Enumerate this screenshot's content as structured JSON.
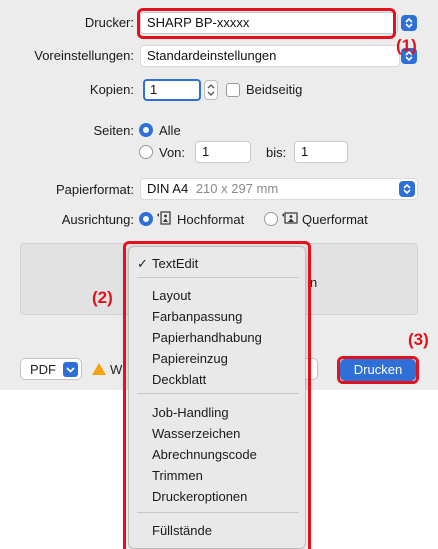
{
  "printer": {
    "label": "Drucker:",
    "value": "SHARP BP-xxxxx"
  },
  "presets": {
    "label": "Voreinstellungen:",
    "value": "Standardeinstellungen"
  },
  "copies": {
    "label": "Kopien:",
    "value": "1",
    "duplex_label": "Beidseitig"
  },
  "pages": {
    "label": "Seiten:",
    "all_label": "Alle",
    "from_label": "Von:",
    "from_value": "1",
    "to_label": "bis:",
    "to_value": "1"
  },
  "paper": {
    "label": "Papierformat:",
    "value": "DIN A4",
    "dimensions": "210 x 297 mm"
  },
  "orientation": {
    "label": "Ausrichtung:",
    "portrait_label": "Hochformat",
    "landscape_label": "Querformat"
  },
  "panel": {
    "partial_text": "n"
  },
  "bottom": {
    "pdf_label": "PDF",
    "warning_partial": "W",
    "print_label": "Drucken"
  },
  "callouts": {
    "c1": "(1)",
    "c2": "(2)",
    "c3": "(3)"
  },
  "menu": {
    "checked_item": "TextEdit",
    "check_mark": "✓",
    "group1": [
      "Layout",
      "Farbanpassung",
      "Papierhandhabung",
      "Papiereinzug",
      "Deckblatt"
    ],
    "group2": [
      "Job-Handling",
      "Wasserzeichen",
      "Abrechnungscode",
      "Trimmen",
      "Druckeroptionen"
    ],
    "group3": [
      "Füllstände"
    ]
  },
  "colors": {
    "accent": "#2f6fd8",
    "callout": "#e3111b",
    "warning": "#f1a40a"
  }
}
